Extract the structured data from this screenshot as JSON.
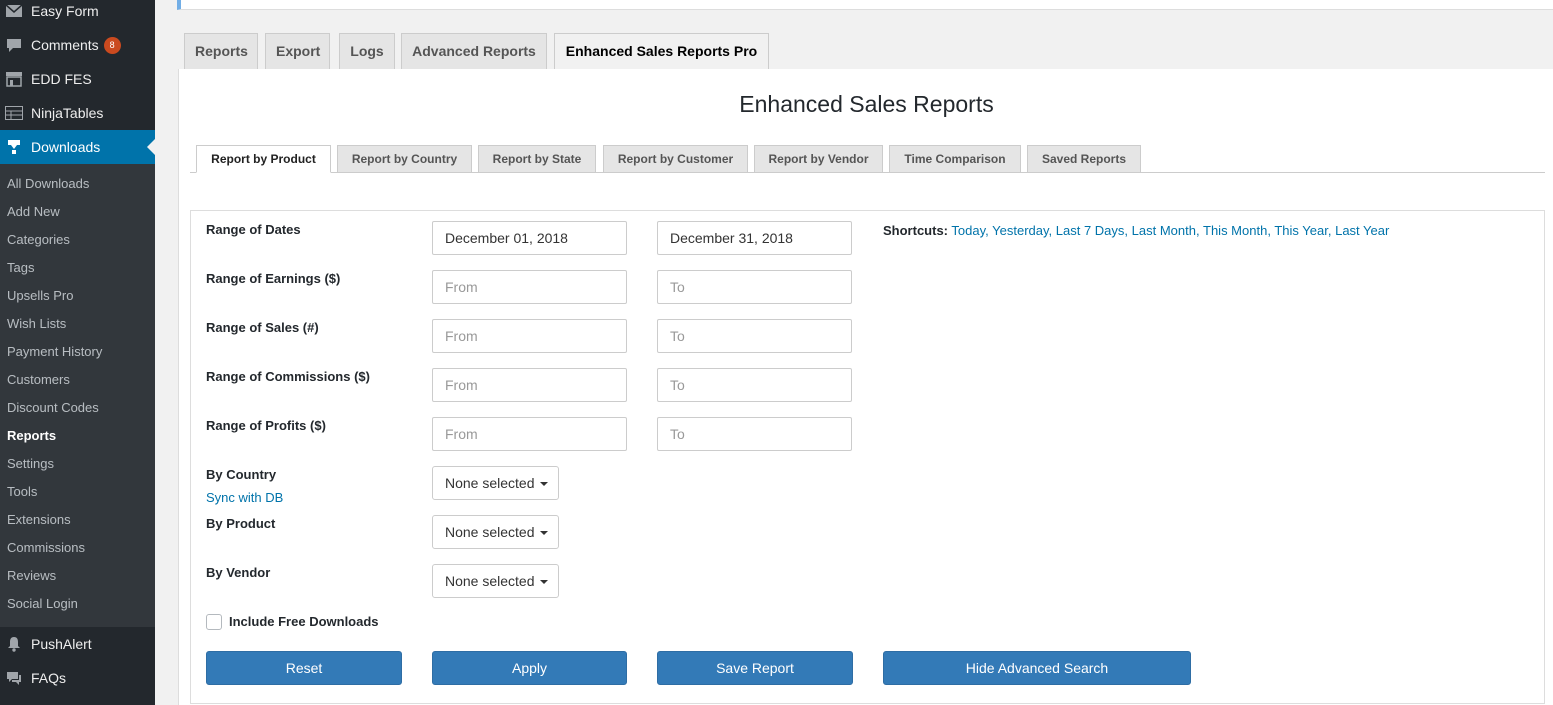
{
  "sidebar": {
    "top_items": [
      {
        "label": "Easy Form",
        "icon": "envelope-icon"
      },
      {
        "label": "Comments",
        "icon": "comment-bubble-icon",
        "badge": "8"
      },
      {
        "label": "EDD FES",
        "icon": "storefront-icon"
      },
      {
        "label": "NinjaTables",
        "icon": "table-icon"
      },
      {
        "label": "Downloads",
        "icon": "download-icon",
        "current": true
      }
    ],
    "submenu": [
      "All Downloads",
      "Add New",
      "Categories",
      "Tags",
      "Upsells Pro",
      "Wish Lists",
      "Payment History",
      "Customers",
      "Discount Codes",
      "Reports",
      "Settings",
      "Tools",
      "Extensions",
      "Commissions",
      "Reviews",
      "Social Login"
    ],
    "active_submenu": "Reports",
    "bottom_items": [
      {
        "label": "PushAlert",
        "icon": "bell-icon"
      },
      {
        "label": "FAQs",
        "icon": "faq-icon"
      }
    ]
  },
  "nav_tabs": [
    "Reports",
    "Export",
    "Logs",
    "Advanced Reports",
    "Enhanced Sales Reports Pro"
  ],
  "active_nav_tab": "Enhanced Sales Reports Pro",
  "page_title": "Enhanced Sales Reports",
  "sub_tabs": [
    "Report by Product",
    "Report by Country",
    "Report by State",
    "Report by Customer",
    "Report by Vendor",
    "Time Comparison",
    "Saved Reports"
  ],
  "active_sub_tab": "Report by Product",
  "form": {
    "range_dates": {
      "label": "Range of Dates",
      "from": "December 01, 2018",
      "to": "December 31, 2018"
    },
    "range_earnings": {
      "label": "Range of Earnings ($)",
      "from_placeholder": "From",
      "to_placeholder": "To"
    },
    "range_sales": {
      "label": "Range of Sales (#)",
      "from_placeholder": "From",
      "to_placeholder": "To"
    },
    "range_commissions": {
      "label": "Range of Commissions ($)",
      "from_placeholder": "From",
      "to_placeholder": "To"
    },
    "range_profits": {
      "label": "Range of Profits ($)",
      "from_placeholder": "From",
      "to_placeholder": "To"
    },
    "by_country": {
      "label": "By Country",
      "sync_link": "Sync with DB",
      "selected": "None selected"
    },
    "by_product": {
      "label": "By Product",
      "selected": "None selected"
    },
    "by_vendor": {
      "label": "By Vendor",
      "selected": "None selected"
    },
    "include_free": {
      "label": "Include Free Downloads",
      "checked": false
    }
  },
  "shortcuts": {
    "label": "Shortcuts:",
    "links": [
      "Today",
      "Yesterday",
      "Last 7 Days",
      "Last Month",
      "This Month",
      "This Year",
      "Last Year"
    ]
  },
  "buttons": {
    "reset": "Reset",
    "apply": "Apply",
    "save_report": "Save Report",
    "hide_advanced": "Hide Advanced Search"
  },
  "colors": {
    "sidebar_bg": "#23282d",
    "submenu_bg": "#32373c",
    "current_menu": "#0073aa",
    "link": "#0073aa",
    "button": "#337ab7",
    "badge": "#ca4a1f"
  }
}
